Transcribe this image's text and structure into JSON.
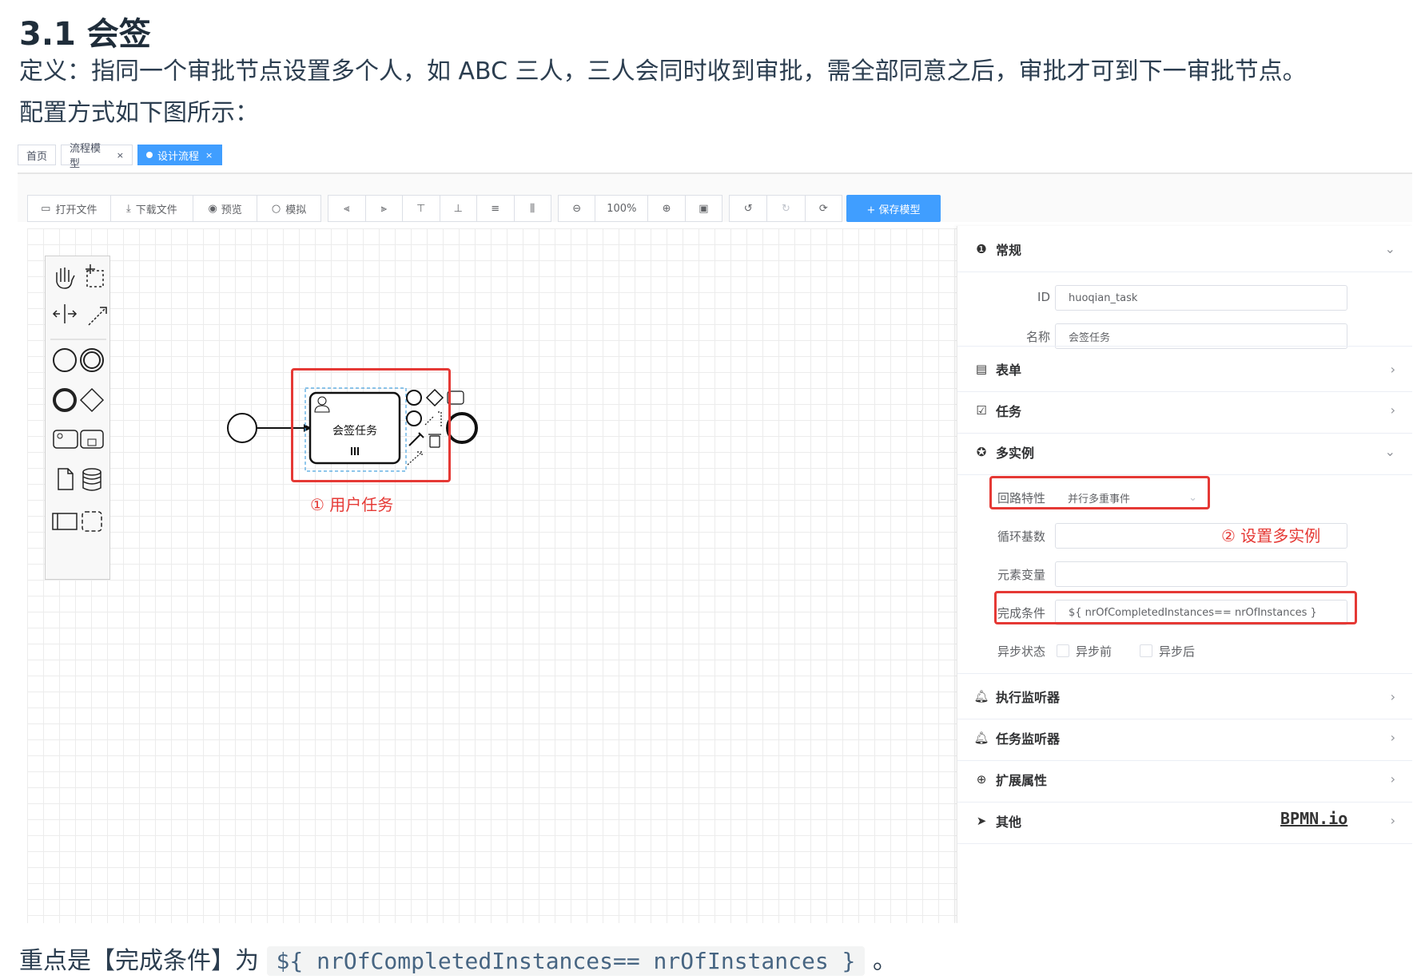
{
  "doc": {
    "heading": "3.1 会签",
    "definition": "定义：指同一个审批节点设置多个人，如 ABC 三人，三人会同时收到审批，需全部同意之后，审批才可到下一审批节点。",
    "config_intro": "配置方式如下图所示：",
    "footer_prefix": "重点是【完成条件】为",
    "footer_code": "${ nrOfCompletedInstances== nrOfInstances }",
    "footer_suffix": "。"
  },
  "tabs": [
    {
      "label": "首页"
    },
    {
      "label": "流程模型",
      "close": "×"
    },
    {
      "label": "设计流程",
      "close": "×"
    }
  ],
  "toolbar": {
    "file_buttons": [
      "打开文件",
      "下载文件",
      "预览",
      "模拟"
    ],
    "zoom_level": "100%",
    "save_label": "+ 保存模型"
  },
  "canvas": {
    "task_label": "会签任务",
    "annotation_task": "① 用户任务",
    "brand": "BPMN.io"
  },
  "panel": {
    "general": {
      "title": "常规",
      "id_label": "ID",
      "id_value": "huoqian_task",
      "name_label": "名称",
      "name_value": "会签任务"
    },
    "form": {
      "title": "表单"
    },
    "task": {
      "title": "任务"
    },
    "multi": {
      "title": "多实例",
      "loop_label": "回路特性",
      "loop_value": "并行多重事件",
      "cardinality_label": "循环基数",
      "cardinality_value": "",
      "element_var_label": "元素变量",
      "element_var_value": "",
      "completion_label": "完成条件",
      "completion_value": "${ nrOfCompletedInstances== nrOfInstances }",
      "async_label": "异步状态",
      "async_before": "异步前",
      "async_after": "异步后",
      "annotation": "② 设置多实例"
    },
    "exec_listener": {
      "title": "执行监听器"
    },
    "task_listener": {
      "title": "任务监听器"
    },
    "extension": {
      "title": "扩展属性"
    },
    "other": {
      "title": "其他"
    }
  },
  "colors": {
    "accent": "#409eff",
    "annotation": "#e53935"
  }
}
